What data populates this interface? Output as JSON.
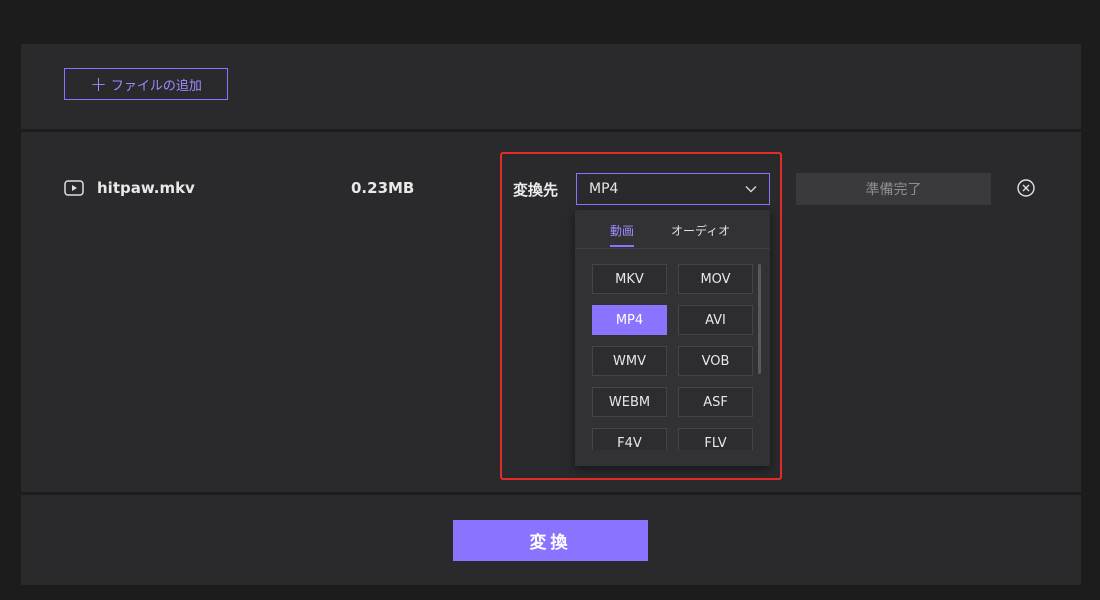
{
  "toolbar": {
    "add_file_label": "ファイルの追加",
    "add_icon": "plus-icon"
  },
  "file": {
    "icon": "play-icon",
    "name": "hitpaw.mkv",
    "size": "0.23MB",
    "convert_to_label": "変換先",
    "selected_format": "MP4",
    "status": "準備完了",
    "remove_icon": "close-circle-icon"
  },
  "dropdown": {
    "tabs": [
      "動画",
      "オーディオ"
    ],
    "active_tab": "動画",
    "formats": [
      "MKV",
      "MOV",
      "MP4",
      "AVI",
      "WMV",
      "VOB",
      "WEBM",
      "ASF",
      "F4V",
      "FLV"
    ],
    "selected": "MP4"
  },
  "actions": {
    "convert_label": "変換"
  },
  "colors": {
    "accent": "#8a73ff",
    "highlight": "#e52a2a",
    "background": "#1c1c1c",
    "panel": "#2a2a2c"
  }
}
